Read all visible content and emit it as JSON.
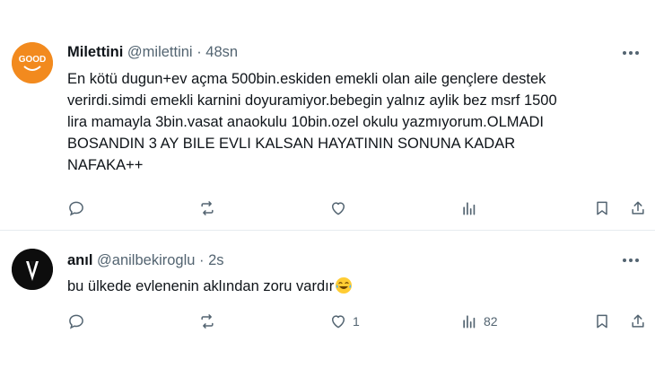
{
  "tweets": [
    {
      "name": "Milettini",
      "handle": "@milettini",
      "dot": "·",
      "time": "48sn",
      "avatar_text": "GOOD",
      "text_lines": [
        "En kötü dugun+ev açma 500bin.eskiden emekli olan aile gençlere destek",
        "verirdi.simdi emekli karnini doyuramiyor.bebegin yalnız aylik bez msrf 1500",
        "lira mamayla 3bin.vasat anaokulu 10bin.ozel okulu yazmıyorum.OLMADI",
        "BOSANDIN 3 AY BILE EVLI KALSAN HAYATININ SONUNA KADAR",
        "NAFAKA++"
      ],
      "likes": "",
      "views": ""
    },
    {
      "name": "anıl",
      "handle": "@anilbekiroglu",
      "dot": "·",
      "time": "2s",
      "text": "bu ülkede evlenenin aklından zoru vardır",
      "emoji": "face-with-tears-of-joy",
      "likes": "1",
      "views": "82"
    }
  ],
  "icons": [
    "reply-icon",
    "retweet-icon",
    "like-icon",
    "views-icon",
    "bookmark-icon",
    "share-icon",
    "more-icon"
  ],
  "colors": {
    "icon": "#536471",
    "text": "#0f1419",
    "avatar1": "#f28a1e",
    "separator": "#e6ecf0"
  }
}
